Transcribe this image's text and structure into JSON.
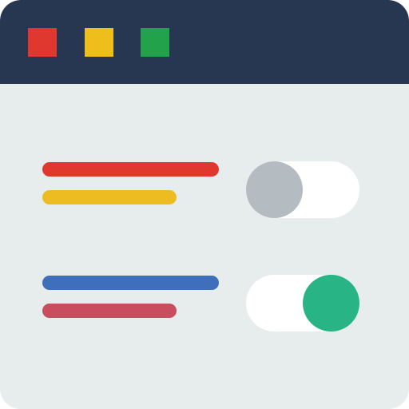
{
  "window": {
    "title_bar": {
      "buttons": [
        {
          "icon": "red-square-icon",
          "color": "#e0382f"
        },
        {
          "icon": "yellow-square-icon",
          "color": "#edbe1c"
        },
        {
          "icon": "green-square-icon",
          "color": "#22a34b"
        }
      ]
    },
    "settings": [
      {
        "primary_line_color": "#e0382f",
        "secondary_line_color": "#edbc20",
        "toggle_state": "off",
        "toggle_color": "#b4bbc1"
      },
      {
        "primary_line_color": "#3f6fbb",
        "secondary_line_color": "#c74d5f",
        "toggle_state": "on",
        "toggle_color": "#29b486"
      }
    ]
  }
}
